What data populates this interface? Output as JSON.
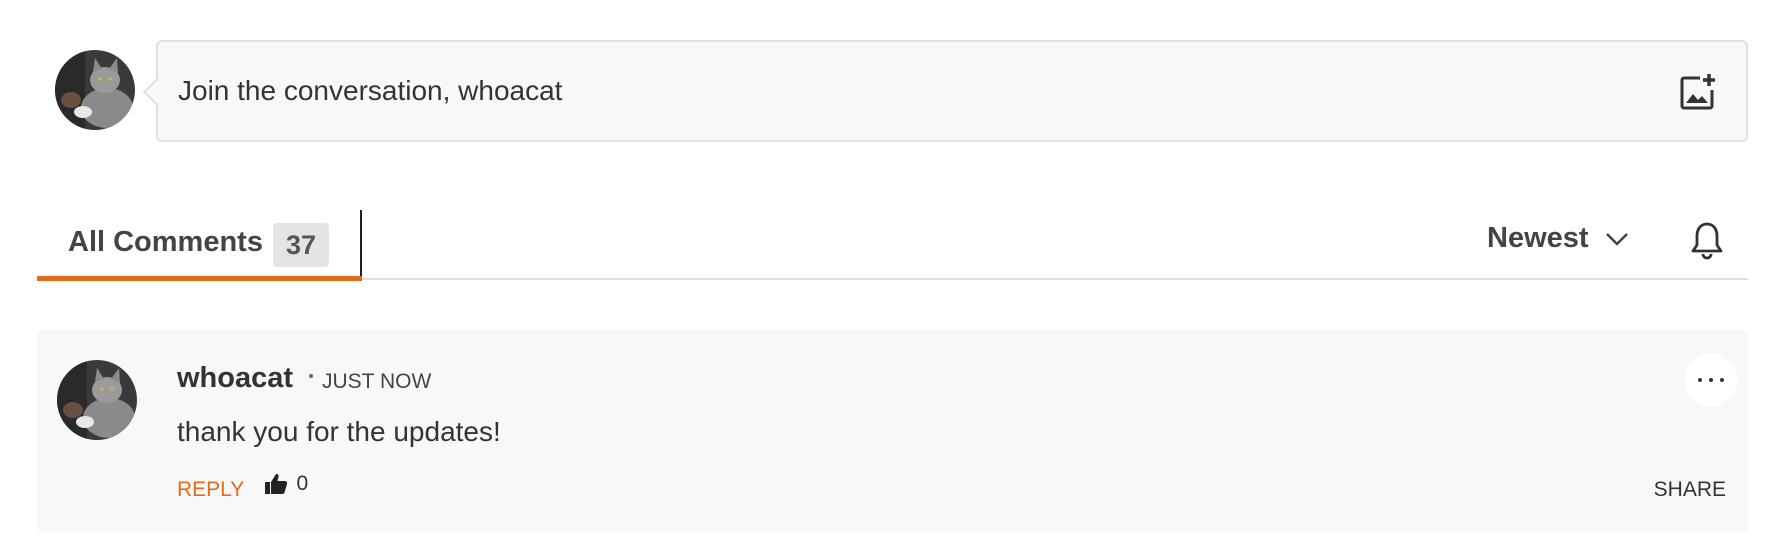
{
  "composer": {
    "placeholder": "Join the conversation, whoacat",
    "avatar_icon": "cat-avatar",
    "add_image_icon": "add-image-icon"
  },
  "tabs": {
    "all_comments_label": "All Comments",
    "all_comments_count": "37",
    "sort_label": "Newest",
    "sort_icon": "chevron-down-icon",
    "notify_icon": "bell-icon"
  },
  "comments": [
    {
      "author": "whoacat",
      "time": "JUST NOW",
      "body": "thank you for the updates!",
      "reply_label": "REPLY",
      "like_count": "0",
      "share_label": "SHARE"
    }
  ],
  "colors": {
    "accent": "#e36b1c",
    "text": "#333333",
    "card_background": "#f8f8f8",
    "border": "#e0e0e0"
  }
}
